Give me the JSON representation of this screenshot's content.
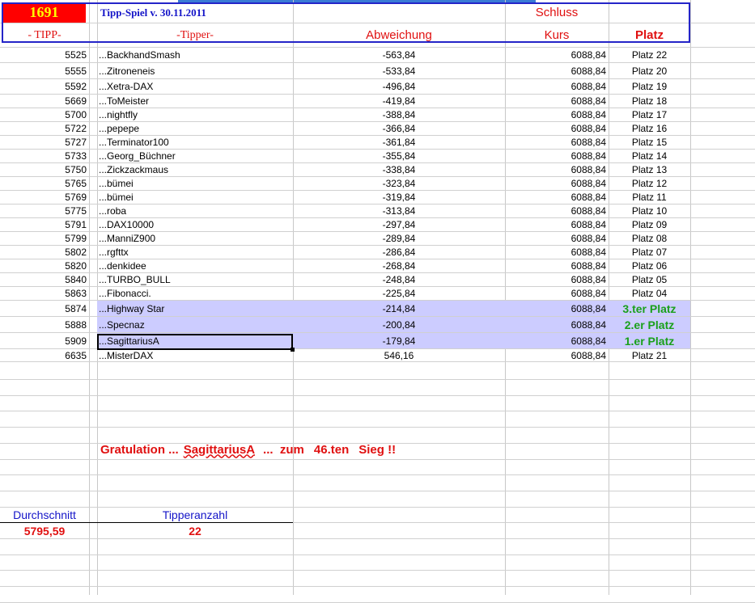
{
  "header": {
    "number": "1691",
    "title": "Tipp-Spiel v. 30.11.2011",
    "schluss": "Schluss",
    "col_tipp": "- TIPP-",
    "col_tipper": "-Tipper-",
    "col_abweichung": "Abweichung",
    "col_kurs": "Kurs",
    "col_platz": "Platz"
  },
  "rows": [
    {
      "tipp": "5525",
      "name": "...BackhandSmash",
      "abw": "-563,84",
      "kurs": "6088,84",
      "platz": "Platz 22"
    },
    {
      "tipp": "5555",
      "name": "...Zitroneneis",
      "abw": "-533,84",
      "kurs": "6088,84",
      "platz": "Platz 20"
    },
    {
      "tipp": "5592",
      "name": "...Xetra-DAX",
      "abw": "-496,84",
      "kurs": "6088,84",
      "platz": "Platz 19"
    },
    {
      "tipp": "5669",
      "name": "...ToMeister",
      "abw": "-419,84",
      "kurs": "6088,84",
      "platz": "Platz 18"
    },
    {
      "tipp": "5700",
      "name": "...nightfly",
      "abw": "-388,84",
      "kurs": "6088,84",
      "platz": "Platz 17"
    },
    {
      "tipp": "5722",
      "name": "...pepepe",
      "abw": "-366,84",
      "kurs": "6088,84",
      "platz": "Platz 16"
    },
    {
      "tipp": "5727",
      "name": "...Terminator100",
      "abw": "-361,84",
      "kurs": "6088,84",
      "platz": "Platz 15"
    },
    {
      "tipp": "5733",
      "name": "...Georg_Büchner",
      "abw": "-355,84",
      "kurs": "6088,84",
      "platz": "Platz 14"
    },
    {
      "tipp": "5750",
      "name": "...Zickzackmaus",
      "abw": "-338,84",
      "kurs": "6088,84",
      "platz": "Platz 13"
    },
    {
      "tipp": "5765",
      "name": "...bümei",
      "abw": "-323,84",
      "kurs": "6088,84",
      "platz": "Platz 12"
    },
    {
      "tipp": "5769",
      "name": "...bümei",
      "abw": "-319,84",
      "kurs": "6088,84",
      "platz": "Platz 11"
    },
    {
      "tipp": "5775",
      "name": "...roba",
      "abw": "-313,84",
      "kurs": "6088,84",
      "platz": "Platz 10"
    },
    {
      "tipp": "5791",
      "name": "...DAX10000",
      "abw": "-297,84",
      "kurs": "6088,84",
      "platz": "Platz 09"
    },
    {
      "tipp": "5799",
      "name": "...ManniZ900",
      "abw": "-289,84",
      "kurs": "6088,84",
      "platz": "Platz 08"
    },
    {
      "tipp": "5802",
      "name": "...rgfttx",
      "abw": "-286,84",
      "kurs": "6088,84",
      "platz": "Platz 07"
    },
    {
      "tipp": "5820",
      "name": "...denkidee",
      "abw": "-268,84",
      "kurs": "6088,84",
      "platz": "Platz 06"
    },
    {
      "tipp": "5840",
      "name": "...TURBO_BULL",
      "abw": "-248,84",
      "kurs": "6088,84",
      "platz": "Platz 05"
    },
    {
      "tipp": "5863",
      "name": "...Fibonacci.",
      "abw": "-225,84",
      "kurs": "6088,84",
      "platz": "Platz 04"
    },
    {
      "tipp": "5874",
      "name": "...Highway Star",
      "abw": "-214,84",
      "kurs": "6088,84",
      "platz": "3.ter Platz"
    },
    {
      "tipp": "5888",
      "name": "...Specnaz",
      "abw": "-200,84",
      "kurs": "6088,84",
      "platz": "2.er Platz"
    },
    {
      "tipp": "5909",
      "name": "...SagittariusA",
      "abw": "-179,84",
      "kurs": "6088,84",
      "platz": "1.er Platz"
    },
    {
      "tipp": "6635",
      "name": "...MisterDAX",
      "abw": "546,16",
      "kurs": "6088,84",
      "platz": "Platz 21"
    }
  ],
  "gratulation": {
    "prefix": "Gratulation ...",
    "winner": "SagittariusA",
    "mid": "...  zum",
    "count": "46.ten",
    "suffix": "Sieg !!"
  },
  "summary": {
    "avg_label": "Durchschnitt",
    "avg_value": "5795,59",
    "count_label": "Tipperanzahl",
    "count_value": "22"
  }
}
